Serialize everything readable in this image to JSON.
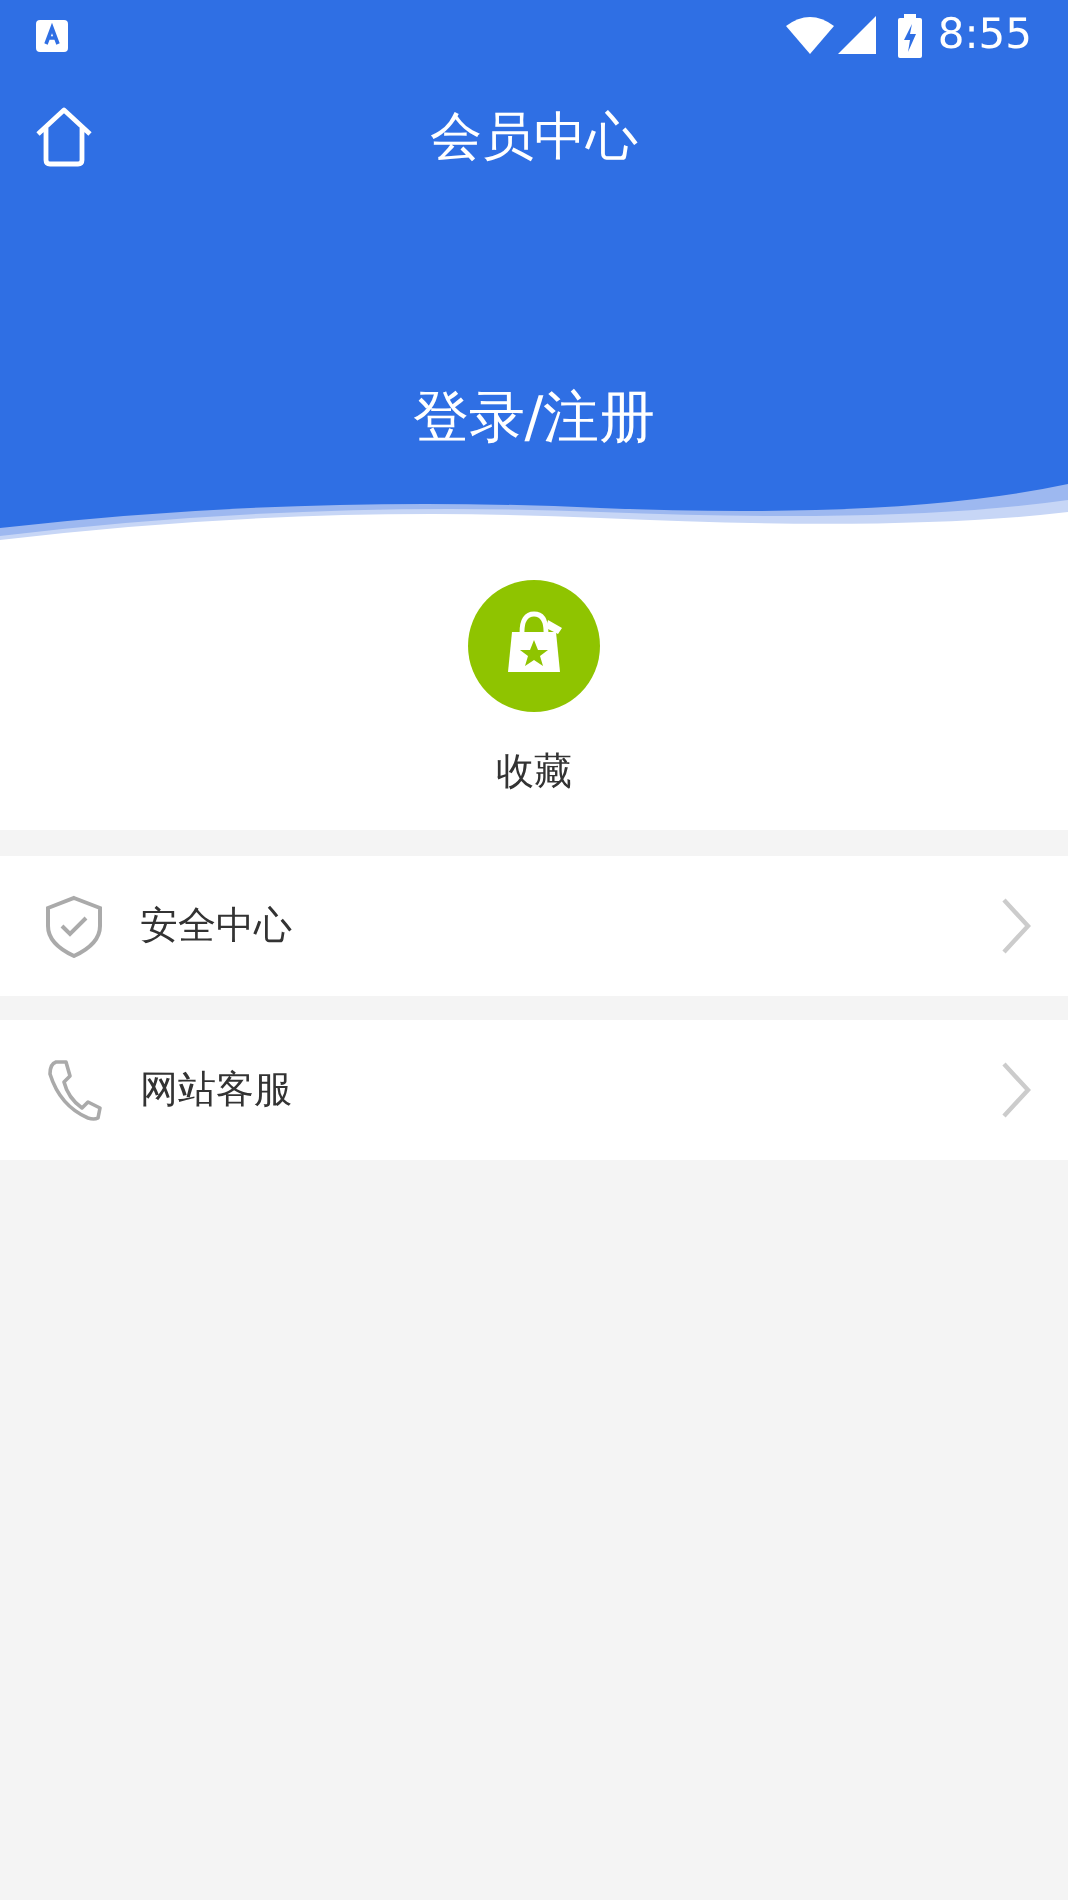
{
  "status_bar": {
    "time": "8:55"
  },
  "header": {
    "title": "会员中心",
    "login": "登录/注册"
  },
  "shortcuts": [
    {
      "label": "收藏"
    }
  ],
  "menu": [
    {
      "label": "安全中心"
    },
    {
      "label": "网站客服"
    }
  ]
}
